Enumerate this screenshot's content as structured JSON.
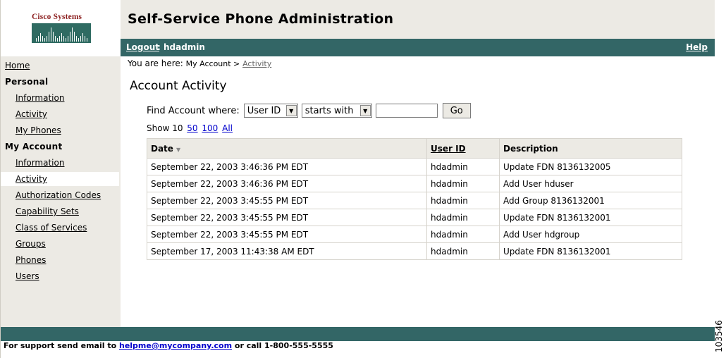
{
  "logo": {
    "text": "Cisco Systems"
  },
  "header": {
    "title": "Self-Service Phone Administration"
  },
  "status_bar": {
    "logout_label": "Logout",
    "separator_user": ": hdadmin",
    "help_label": "Help"
  },
  "sidebar": {
    "home": "Home",
    "personal_heading": "Personal",
    "personal_items": [
      "Information",
      "Activity",
      "My Phones"
    ],
    "account_heading": "My Account",
    "account_items": [
      "Information",
      "Activity",
      "Authorization Codes",
      "Capability Sets",
      "Class of Services",
      "Groups",
      "Phones",
      "Users"
    ],
    "active_item": "Activity"
  },
  "breadcrumb": {
    "prefix": "You are here:",
    "path": "My Account >",
    "current": "Activity"
  },
  "main": {
    "title": "Account Activity",
    "find_label": "Find Account where:",
    "field_select": "User ID",
    "operator_select": "starts with",
    "search_value": "",
    "go_label": "Go",
    "show_prefix": "Show 10",
    "page_sizes": [
      "50",
      "100",
      "All"
    ]
  },
  "table": {
    "headers": {
      "date": "Date",
      "user": "User ID",
      "description": "Description"
    },
    "rows": [
      {
        "date": "September 22, 2003 3:46:36 PM EDT",
        "user": "hdadmin",
        "description": "Update FDN 8136132005"
      },
      {
        "date": "September 22, 2003 3:46:36 PM EDT",
        "user": "hdadmin",
        "description": "Add User hduser"
      },
      {
        "date": "September 22, 2003 3:45:55 PM EDT",
        "user": "hdadmin",
        "description": "Add Group 8136132001"
      },
      {
        "date": "September 22, 2003 3:45:55 PM EDT",
        "user": "hdadmin",
        "description": "Update FDN 8136132001"
      },
      {
        "date": "September 22, 2003 3:45:55 PM EDT",
        "user": "hdadmin",
        "description": "Add User hdgroup"
      },
      {
        "date": "September 17, 2003 11:43:38 AM EDT",
        "user": "hdadmin",
        "description": "Update FDN 8136132001"
      }
    ]
  },
  "footer": {
    "prefix": "For support send email to",
    "email": "helpme@mycompany.com",
    "suffix": "or call 1-800-555-5555"
  },
  "figure_number": "103546",
  "colors": {
    "teal": "#336666",
    "panel": "#eceae4",
    "logo_red": "#8b1e1e"
  }
}
